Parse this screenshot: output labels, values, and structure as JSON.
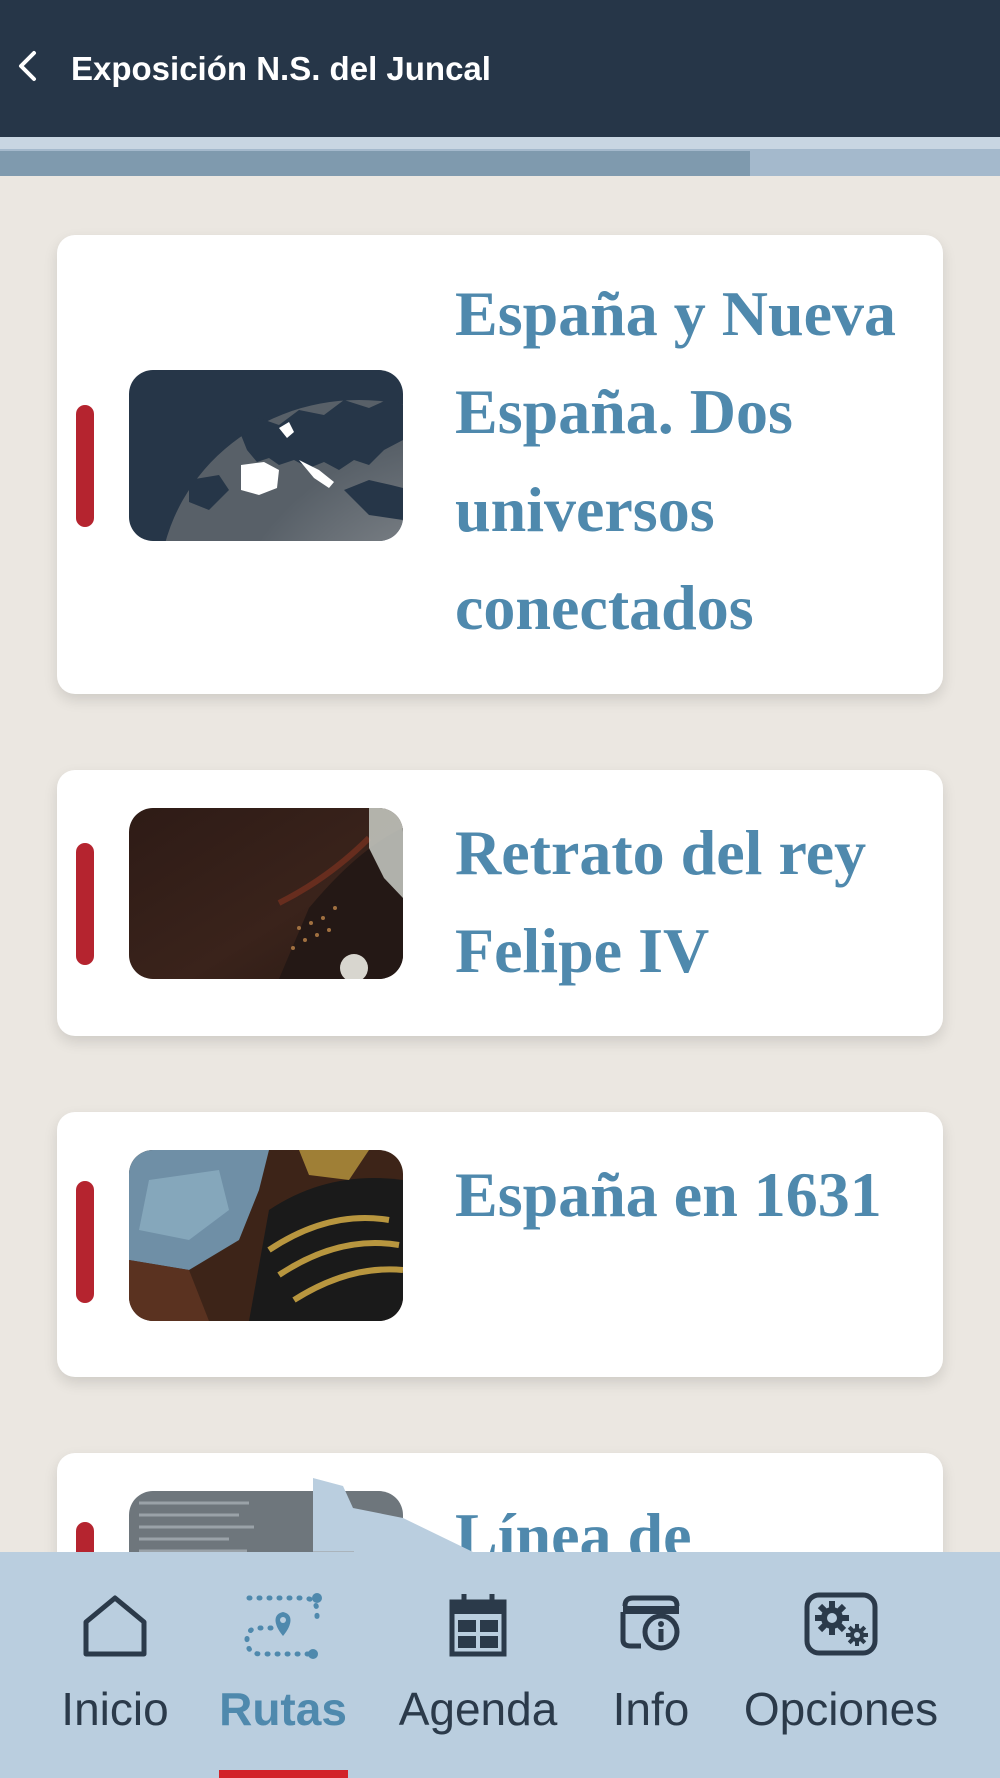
{
  "header": {
    "title": "Exposición N.S. del Juncal",
    "back_icon": "chevron-left-icon"
  },
  "progress": {
    "fraction": 0.75
  },
  "colors": {
    "header_bg": "#263648",
    "accent_red": "#b5242f",
    "card_title": "#4f89ad",
    "nav_bg": "#bacedf",
    "nav_active": "#4f89ad"
  },
  "cards": [
    {
      "title": "España y Nueva España. Dos universos conectados",
      "thumbnail": "world-map-image"
    },
    {
      "title": "Retrato del rey Felipe IV",
      "thumbnail": "painting-detail-image"
    },
    {
      "title": "España en 1631",
      "thumbnail": "armor-painting-image"
    },
    {
      "title": "Línea de",
      "thumbnail": "document-image"
    }
  ],
  "nav": {
    "items": [
      {
        "label": "Inicio",
        "icon": "home-icon",
        "active": false
      },
      {
        "label": "Rutas",
        "icon": "route-icon",
        "active": true
      },
      {
        "label": "Agenda",
        "icon": "calendar-icon",
        "active": false
      },
      {
        "label": "Info",
        "icon": "info-icon",
        "active": false
      },
      {
        "label": "Opciones",
        "icon": "gear-icon",
        "active": false
      }
    ]
  }
}
